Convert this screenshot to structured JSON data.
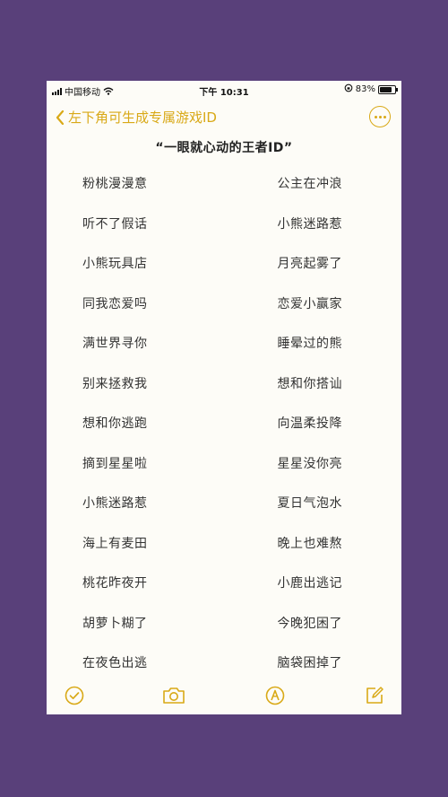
{
  "status_bar": {
    "carrier": "中国移动",
    "time": "下午 10:31",
    "battery": "83%"
  },
  "nav": {
    "back_label": "左下角可生成专属游戏ID"
  },
  "note": {
    "title": "“一眼就心动的王者ID”",
    "rows": [
      {
        "left": "粉桃漫漫意",
        "right": "公主在冲浪"
      },
      {
        "left": "听不了假话",
        "right": "小熊迷路惹"
      },
      {
        "left": "小熊玩具店",
        "right": "月亮起雾了"
      },
      {
        "left": "同我恋爱吗",
        "right": "恋爱小赢家"
      },
      {
        "left": "满世界寻你",
        "right": "睡晕过的熊"
      },
      {
        "left": "别来拯救我",
        "right": "想和你搭讪"
      },
      {
        "left": "想和你逃跑",
        "right": "向温柔投降"
      },
      {
        "left": "摘到星星啦",
        "right": "星星没你亮"
      },
      {
        "left": "小熊迷路惹",
        "right": "夏日气泡水"
      },
      {
        "left": "海上有麦田",
        "right": "晚上也难熬"
      },
      {
        "left": "桃花昨夜开",
        "right": "小鹿出逃记"
      },
      {
        "left": "胡萝卜糊了",
        "right": "今晚犯困了"
      },
      {
        "left": "在夜色出逃",
        "right": "脑袋困掉了"
      }
    ]
  },
  "colors": {
    "accent": "#d9a917",
    "background": "#59407a",
    "note_paper": "#fdfcf7"
  },
  "icons": {
    "back": "chevron-left-icon",
    "more": "ellipsis-circle-icon",
    "checklist": "checkmark-circle-icon",
    "camera": "camera-icon",
    "markup": "pen-tip-circle-icon",
    "compose": "compose-icon"
  }
}
